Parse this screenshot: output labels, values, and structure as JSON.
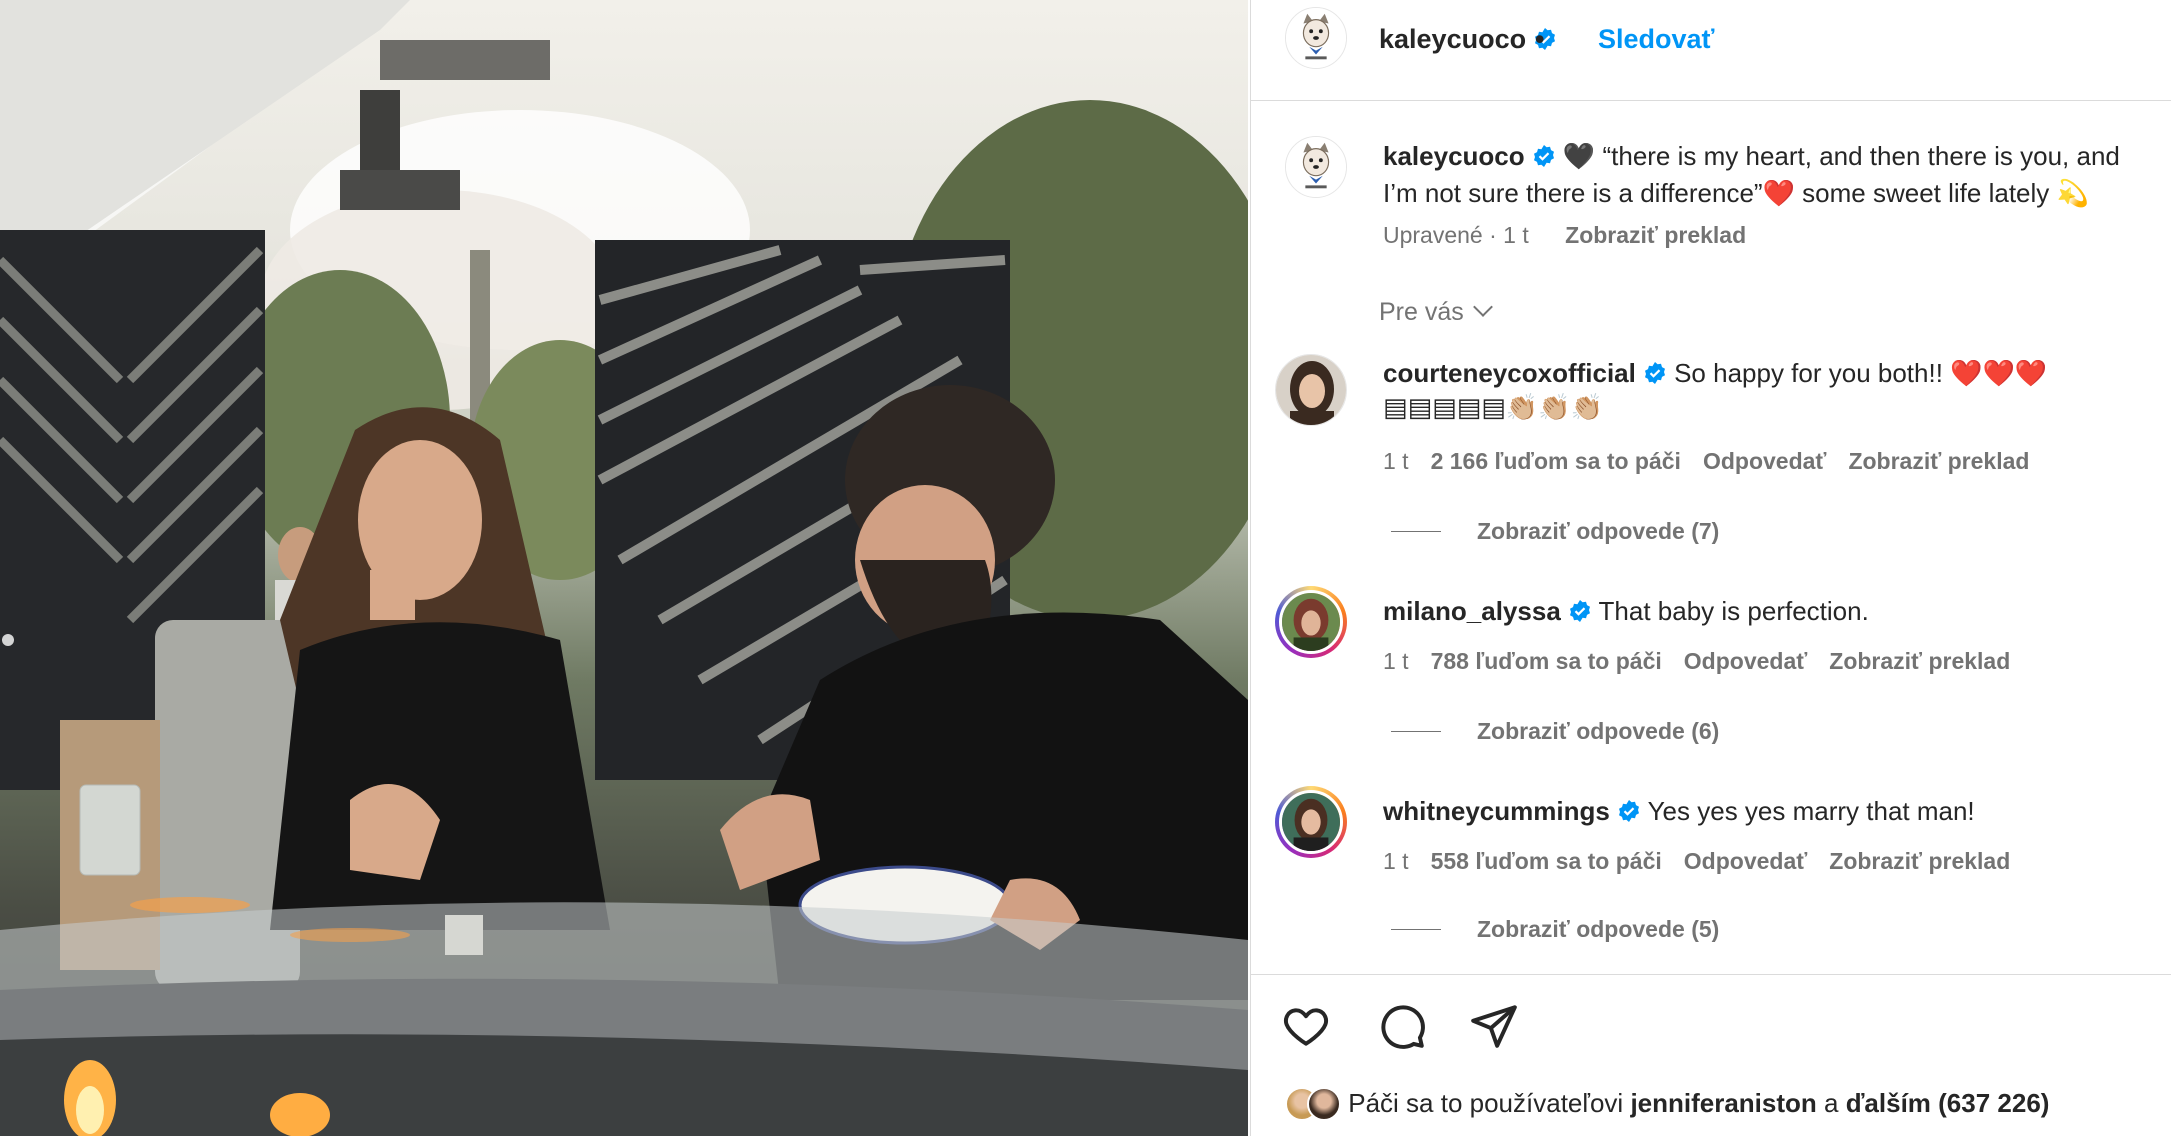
{
  "post": {
    "username": "kaleycuoco",
    "follow_label": "Sledovať",
    "separator": "•"
  },
  "caption": {
    "username": "kaleycuoco",
    "text": "🖤 “there is my heart, and then there is you, and I’m not sure there is a difference”❤️ some sweet life lately 💫",
    "edited": "Upravené · 1 t",
    "translate": "Zobraziť preklad"
  },
  "sort_label": "Pre vás",
  "comments": [
    {
      "username": "courteneycoxofficial",
      "text": "So happy for you both!! ❤️❤️❤️▤▤▤▤▤👏🏼👏🏼👏🏼",
      "time": "1 t",
      "likes": "2 166 ľuďom sa to páči",
      "reply": "Odpovedať",
      "translate": "Zobraziť preklad",
      "replies": "Zobraziť odpovede (7)"
    },
    {
      "username": "milano_alyssa",
      "text": "That baby is perfection.",
      "time": "1 t",
      "likes": "788 ľuďom sa to páči",
      "reply": "Odpovedať",
      "translate": "Zobraziť preklad",
      "replies": "Zobraziť odpovede (6)"
    },
    {
      "username": "whitneycummings",
      "text": "Yes yes yes marry that man!",
      "time": "1 t",
      "likes": "558 ľuďom sa to páči",
      "reply": "Odpovedať",
      "translate": "Zobraziť preklad",
      "replies": "Zobraziť odpovede (5)"
    }
  ],
  "likes_line": {
    "prefix": "Páči sa to používateľovi",
    "user": "jenniferaniston",
    "conj": "a",
    "others": "ďalším (637 226)"
  },
  "icons": {
    "like": "heart-icon",
    "comment": "comment-icon",
    "share": "paper-plane-icon",
    "verified": "verified-badge-icon"
  },
  "colors": {
    "follow": "#0095f6",
    "verified": "#0095f6",
    "muted": "#737373",
    "text": "#262626"
  }
}
